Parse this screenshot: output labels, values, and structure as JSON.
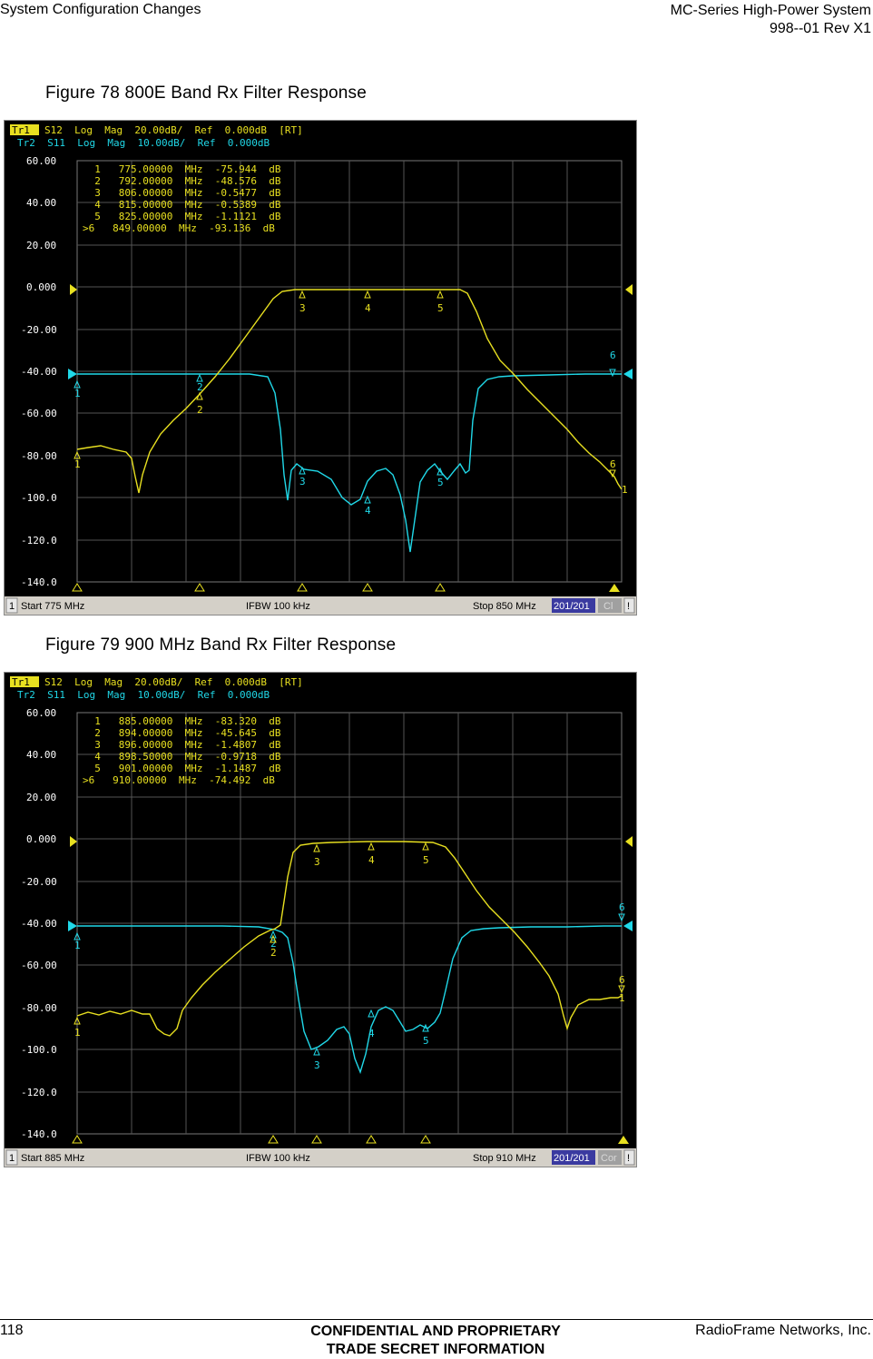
{
  "header": {
    "left": "System Configuration Changes",
    "right_line1": "MC-Series High-Power System",
    "right_line2": "998--01 Rev X1"
  },
  "figures": [
    {
      "caption": "Figure 78  800E Band Rx Filter Response",
      "tr1_tag": "Tr1",
      "tr1_text": "S12  Log  Mag  20.00dB/  Ref  0.000dB  [RT]",
      "tr2_text": "Tr2  S11  Log  Mag  10.00dB/  Ref  0.000dB",
      "y_ticks": [
        "60.00",
        "40.00",
        "20.00",
        "0.000",
        "-20.00",
        "-40.00",
        "-60.00",
        "-80.00",
        "-100.0",
        "-120.0",
        "-140.0"
      ],
      "markers": [
        "  1   775.00000  MHz  -75.944  dB",
        "  2   792.00000  MHz  -48.576  dB",
        "  3   806.00000  MHz  -0.5477  dB",
        "  4   815.00000  MHz  -0.5389  dB",
        "  5   825.00000  MHz  -1.1121  dB",
        ">6   849.00000  MHz  -93.136  dB"
      ],
      "status": {
        "channel": "1",
        "start": "Start 775 MHz",
        "ifbw": "IFBW 100 kHz",
        "stop": "Stop 850 MHz",
        "points": "201/201",
        "mode": "Cl",
        "flag": "!"
      }
    },
    {
      "caption": "Figure 79  900 MHz Band Rx Filter Response",
      "tr1_tag": "Tr1",
      "tr1_text": "S12  Log  Mag  20.00dB/  Ref  0.000dB  [RT]",
      "tr2_text": "Tr2  S11  Log  Mag  10.00dB/  Ref  0.000dB",
      "y_ticks": [
        "60.00",
        "40.00",
        "20.00",
        "0.000",
        "-20.00",
        "-40.00",
        "-60.00",
        "-80.00",
        "-100.0",
        "-120.0",
        "-140.0"
      ],
      "markers": [
        "  1   885.00000  MHz  -83.320  dB",
        "  2   894.00000  MHz  -45.645  dB",
        "  3   896.00000  MHz  -1.4807  dB",
        "  4   898.50000  MHz  -0.9718  dB",
        "  5   901.00000  MHz  -1.1487  dB",
        ">6   910.00000  MHz  -74.492  dB"
      ],
      "status": {
        "channel": "1",
        "start": "Start 885 MHz",
        "ifbw": "IFBW 100 kHz",
        "stop": "Stop 910 MHz",
        "points": "201/201",
        "mode": "Cor",
        "flag": "!"
      }
    }
  ],
  "footer": {
    "page_number": "118",
    "center_line1": "CONFIDENTIAL AND PROPRIETARY",
    "center_line2": "TRADE SECRET INFORMATION",
    "right": "RadioFrame Networks, Inc."
  },
  "colors": {
    "trace1": "#e8e020",
    "trace2": "#20d8e8",
    "grid": "#555555",
    "screen": "#000000"
  }
}
